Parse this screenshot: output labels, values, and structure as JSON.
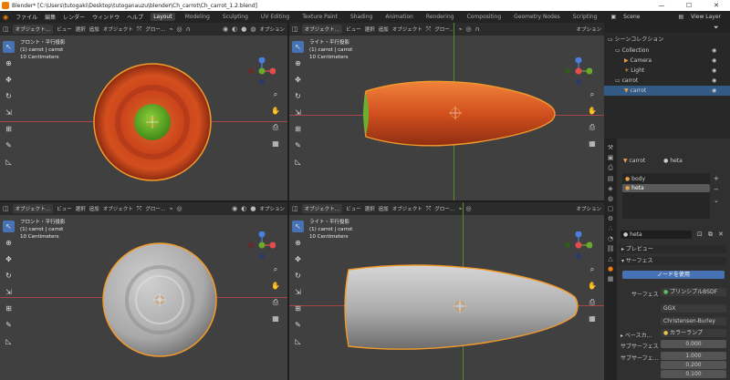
{
  "window": {
    "title": "Blender* [C:\\Users\\tutogaki\\Desktop\\tutoganauzu\\blender\\Ch_carrot\\Ch_carrot_1.2.blend]",
    "min": "—",
    "max": "☐",
    "close": "✕"
  },
  "menu": {
    "items": [
      "ファイル",
      "編集",
      "レンダー",
      "ウィンドウ",
      "ヘルプ"
    ],
    "workspaces": [
      "Layout",
      "Modeling",
      "Sculpting",
      "UV Editing",
      "Texture Paint",
      "Shading",
      "Animation",
      "Rendering",
      "Compositing",
      "Geometry Nodes",
      "Scripting"
    ],
    "active_workspace": "Layout",
    "scene": "Scene",
    "view_layer": "View Layer"
  },
  "viewport_header": {
    "mode": "オブジェクト…",
    "view": "ビュー",
    "select": "選択",
    "add": "追加",
    "object": "オブジェクト",
    "orientation": "グロー…",
    "options": "オプション"
  },
  "viewports": [
    {
      "view_name": "フロント・平行投影",
      "object_info": "(1) carrot | carrot",
      "scale": "10 Centimeters"
    },
    {
      "view_name": "ライト・平行投影",
      "object_info": "(1) carrot | carrot",
      "scale": "10 Centimeters"
    },
    {
      "view_name": "フロント・平行投影",
      "object_info": "(1) carrot | carrot",
      "scale": "10 Centimeters"
    },
    {
      "view_name": "ライト・平行投影",
      "object_info": "(1) carrot | carrot",
      "scale": "10 Centimeters"
    }
  ],
  "gizmo_labels": {
    "x": "X",
    "y": "Y",
    "z": "Z"
  },
  "outliner": {
    "header": "シーンコレクション",
    "rows": [
      {
        "label": "Collection"
      },
      {
        "label": "Camera"
      },
      {
        "label": "Light"
      },
      {
        "label": "carrot"
      },
      {
        "label": "carrot"
      }
    ]
  },
  "properties": {
    "object_name": "carrot",
    "material_name": "heta",
    "slots": [
      "body",
      "heta"
    ],
    "material_field": "heta",
    "section_preview": "プレビュー",
    "section_surface": "サーフェス",
    "use_nodes_button": "ノードを使用",
    "surface_label": "サーフェス",
    "surface_value": "プリンシプルBSDF",
    "distribution": "GGX",
    "subsurface_method": "Christensen-Burley",
    "base_color_label": "ベースカ…",
    "base_color_value": "カラーランプ",
    "subsurface_label": "サブサーフェス",
    "subsurface_value": "0.000",
    "subsurface_radius_label": "サブサーフェ…",
    "subsurface_radius_values": [
      "1.000",
      "0.200",
      "0.100"
    ]
  },
  "colors": {
    "accent": "#4772b3",
    "brand": "#e87d0d",
    "selection": "#335a85"
  }
}
